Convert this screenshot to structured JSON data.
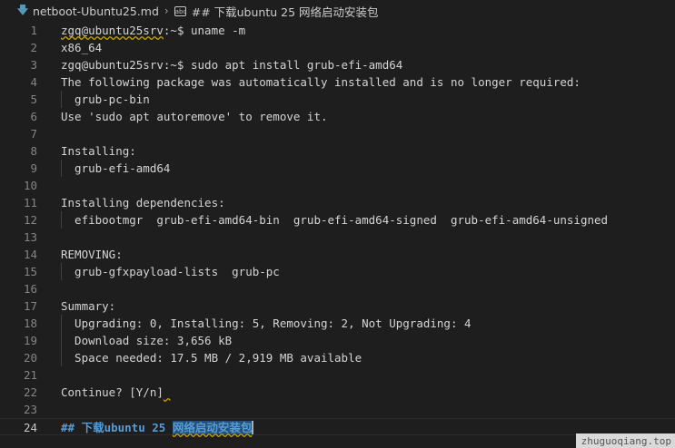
{
  "breadcrumb": {
    "file_icon": "markdown-file-icon",
    "file": "netboot-Ubuntu25.md",
    "separator_icon": "chevron-right-icon",
    "symbol_icon": "string-symbol-icon",
    "symbol": "## 下载ubuntu 25 网络启动安装包"
  },
  "lines": [
    {
      "n": "1",
      "text": "zgq@ubuntu25srv:~$ uname -m"
    },
    {
      "n": "2",
      "text": "x86_64"
    },
    {
      "n": "3",
      "text": "zgq@ubuntu25srv:~$ sudo apt install grub-efi-amd64"
    },
    {
      "n": "4",
      "text": "The following package was automatically installed and is no longer required:"
    },
    {
      "n": "5",
      "text": "  grub-pc-bin"
    },
    {
      "n": "6",
      "text": "Use 'sudo apt autoremove' to remove it."
    },
    {
      "n": "7",
      "text": ""
    },
    {
      "n": "8",
      "text": "Installing:"
    },
    {
      "n": "9",
      "text": "  grub-efi-amd64"
    },
    {
      "n": "10",
      "text": ""
    },
    {
      "n": "11",
      "text": "Installing dependencies:"
    },
    {
      "n": "12",
      "text": "  efibootmgr  grub-efi-amd64-bin  grub-efi-amd64-signed  grub-efi-amd64-unsigned"
    },
    {
      "n": "13",
      "text": ""
    },
    {
      "n": "14",
      "text": "REMOVING:"
    },
    {
      "n": "15",
      "text": "  grub-gfxpayload-lists  grub-pc"
    },
    {
      "n": "16",
      "text": ""
    },
    {
      "n": "17",
      "text": "Summary:"
    },
    {
      "n": "18",
      "text": "  Upgrading: 0, Installing: 5, Removing: 2, Not Upgrading: 4"
    },
    {
      "n": "19",
      "text": "  Download size: 3,656 kB"
    },
    {
      "n": "20",
      "text": "  Space needed: 17.5 MB / 2,919 MB available"
    },
    {
      "n": "21",
      "text": ""
    },
    {
      "n": "22",
      "text": "Continue? [Y/n]"
    },
    {
      "n": "23",
      "text": ""
    }
  ],
  "line1_parts": {
    "user": "zgq@ubuntu25srv",
    "rest": ":~$ uname -m"
  },
  "current_line": {
    "n": "24",
    "prefix": "## 下载ubuntu 25 ",
    "selected": "网络启动安装包"
  },
  "watermark": "zhuguoqiang.top",
  "colors": {
    "background": "#1e1e1e",
    "text": "#d4d4d4",
    "line_number": "#858585",
    "heading": "#569cd6",
    "selection": "#264f78",
    "squiggle": "#cca700"
  }
}
